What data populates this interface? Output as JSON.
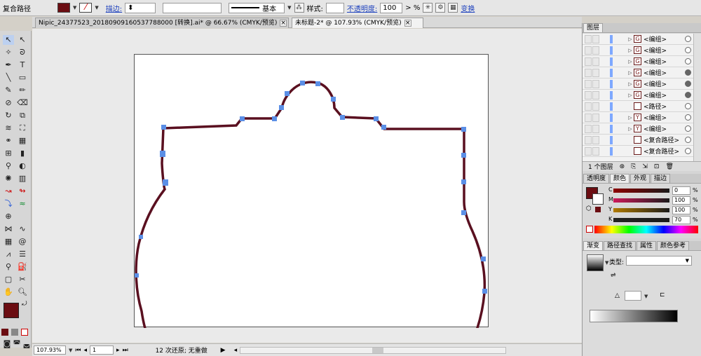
{
  "control": {
    "type_label": "复合路径",
    "stroke_link": "描边:",
    "stroke_style": "基本",
    "style_label": "样式:",
    "opacity_link": "不透明度:",
    "opacity_value": "100",
    "percent": ">  %",
    "transform_link": "变换",
    "fill_color": "#6b0d12"
  },
  "tabs": [
    {
      "label": "Nipic_24377523_20180909160537788000 [转换].ai* @ 66.67% (CMYK/预览)",
      "close": "×"
    },
    {
      "label": "未标题-2* @ 107.93% (CMYK/预览)",
      "close": "×"
    }
  ],
  "layers": {
    "tab": "图层",
    "rows": [
      {
        "name": "<编组>",
        "thumb": "G",
        "target": "ring"
      },
      {
        "name": "<编组>",
        "thumb": "G",
        "target": "ring"
      },
      {
        "name": "<编组>",
        "thumb": "G",
        "target": "ring"
      },
      {
        "name": "<编组>",
        "thumb": "G",
        "target": "fill"
      },
      {
        "name": "<编组>",
        "thumb": "G",
        "target": "fill"
      },
      {
        "name": "<编组>",
        "thumb": "G",
        "target": "fill"
      },
      {
        "name": "<路径>",
        "thumb": "",
        "target": "ring"
      },
      {
        "name": "<编组>",
        "thumb": "Y",
        "target": "ring"
      },
      {
        "name": "<编组>",
        "thumb": "Y",
        "target": "ring"
      },
      {
        "name": "<复合路径>",
        "thumb": "",
        "target": "ring"
      },
      {
        "name": "<复合路径>",
        "thumb": "",
        "target": "ring"
      }
    ],
    "footer": "1 个图层"
  },
  "color": {
    "tabs": [
      "透明度",
      "颜色",
      "外观",
      "描边"
    ],
    "active": "颜色",
    "sliders": [
      {
        "label": "C",
        "value": "0",
        "color": "#8b0000"
      },
      {
        "label": "M",
        "value": "100",
        "color": "#cc1a5a"
      },
      {
        "label": "Y",
        "value": "100",
        "color": "#b07a00"
      },
      {
        "label": "K",
        "value": "70",
        "color": "#222222"
      }
    ],
    "unit": "%"
  },
  "gradient": {
    "tabs": [
      "渐变",
      "路径查找",
      "属性",
      "颜色参考"
    ],
    "active": "渐变",
    "type_label": "类型:"
  },
  "status": {
    "zoom": "107.93%",
    "page": "1",
    "undo": "12 次还原; 无重做"
  }
}
